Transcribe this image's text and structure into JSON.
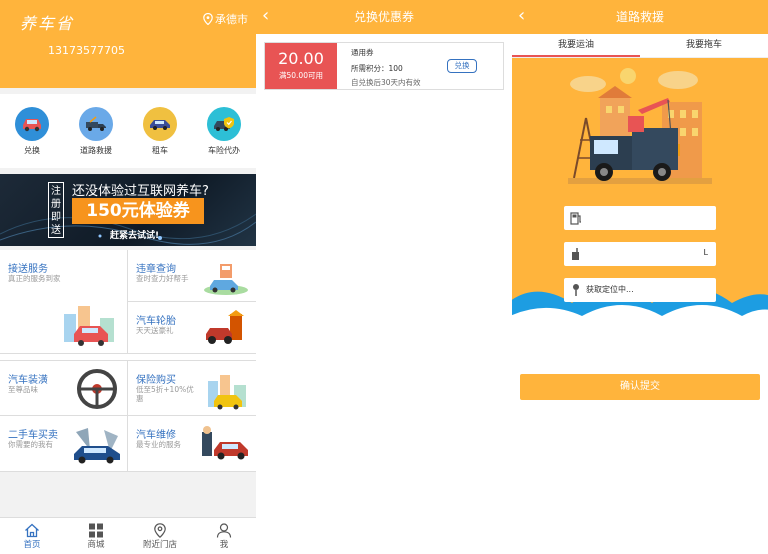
{
  "home": {
    "logo": "养车省",
    "city": "承德市",
    "phone": "13173577705",
    "icons": [
      {
        "label": "兑换",
        "color": "#2f8fd8",
        "icon": "car-icon"
      },
      {
        "label": "道路救援",
        "color": "#6aa9e8",
        "icon": "tow-truck-icon"
      },
      {
        "label": "租车",
        "color": "#f0c040",
        "icon": "rental-car-icon"
      },
      {
        "label": "车险代办",
        "color": "#2dbfd6",
        "icon": "insurance-car-icon"
      }
    ],
    "banner": {
      "tag": "注册即送",
      "line1": "还没体验过互联网养车?",
      "coupon": "150元体验券",
      "line3": "赶紧去试试!"
    },
    "services": [
      {
        "title": "接送服务",
        "sub": "真正的服务到家"
      },
      {
        "title": "违章查询",
        "sub": "查时查力好帮手"
      },
      {
        "title": "汽车轮胎",
        "sub": "天天送豪礼"
      },
      {
        "title": "汽车装潢",
        "sub": "至尊品味"
      },
      {
        "title": "保险购买",
        "sub": "低至5折+10%优惠"
      },
      {
        "title": "二手车买卖",
        "sub": "你需要的我有"
      },
      {
        "title": "汽车维修",
        "sub": "最专业的服务"
      }
    ],
    "tabbar": [
      "首页",
      "商城",
      "附近门店",
      "我"
    ]
  },
  "coupon_page": {
    "title": "兑换优惠券",
    "amount": "20.00",
    "condition": "满50.00可用",
    "name": "通用券",
    "points": "所需积分：100",
    "validity": "自兑换后30天内有效",
    "button": "兑换"
  },
  "rescue_page": {
    "title": "道路救援",
    "tabs": [
      "我要运油",
      "我要拖车"
    ],
    "fuel_type_value": "",
    "volume_value": "",
    "volume_unit": "L",
    "location_value": "获取定位中...",
    "submit": "确认提交"
  },
  "colors": {
    "primary": "#ffb43c",
    "blue": "#3572c0",
    "red": "#e85454",
    "cloud": "#1d9de2"
  }
}
